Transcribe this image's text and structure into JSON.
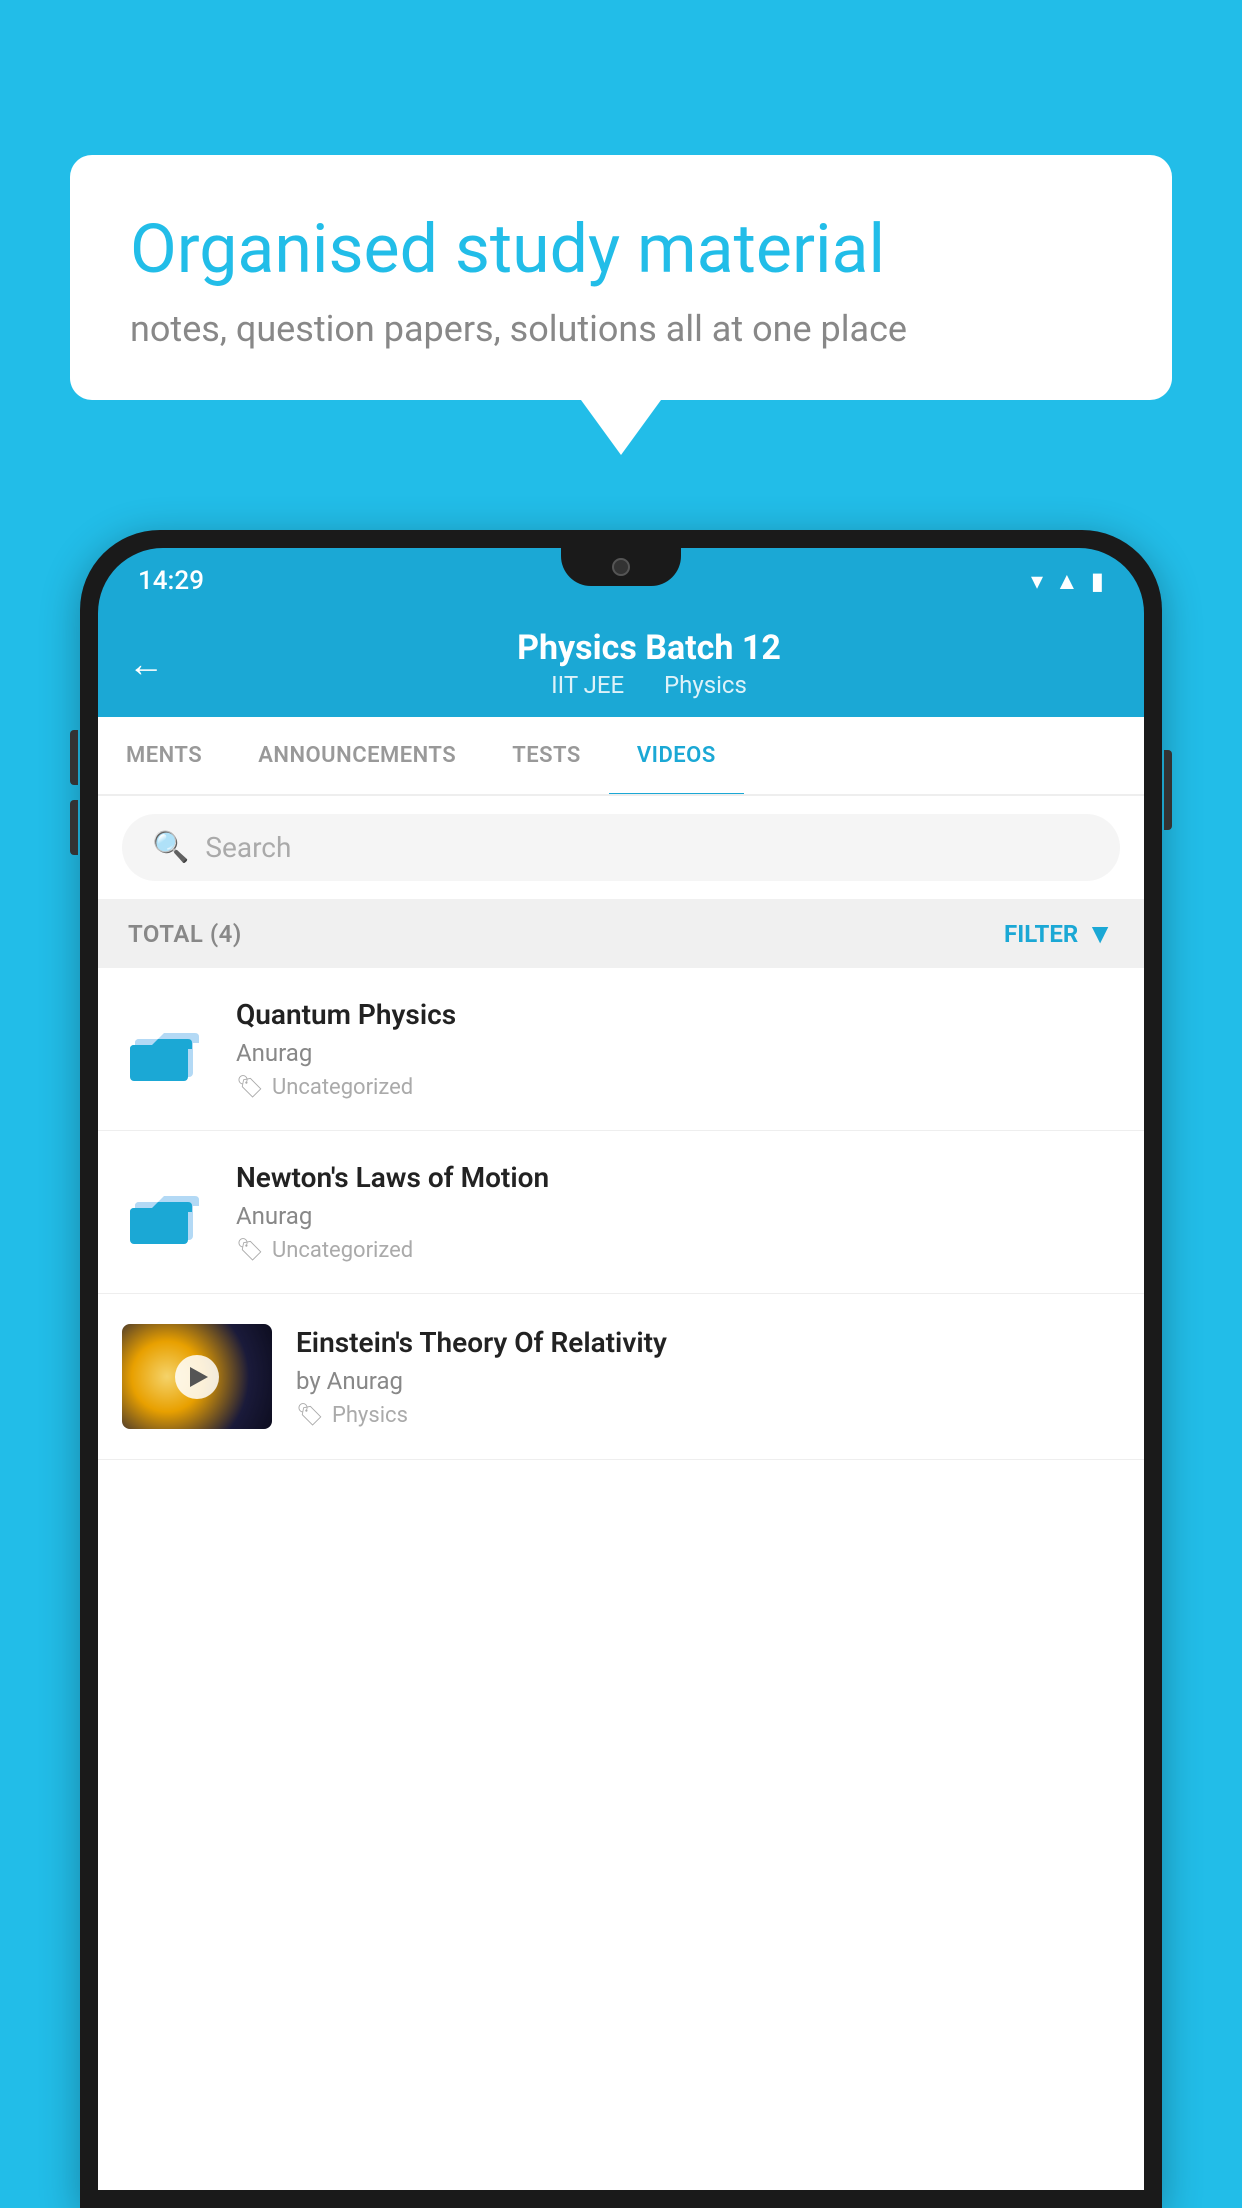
{
  "background": {
    "color": "#22BDE8"
  },
  "speech_bubble": {
    "title": "Organised study material",
    "subtitle": "notes, question papers, solutions all at one place"
  },
  "phone": {
    "status_bar": {
      "time": "14:29",
      "icons": [
        "wifi",
        "signal",
        "battery"
      ]
    },
    "header": {
      "back_label": "←",
      "title": "Physics Batch 12",
      "subtitle_part1": "IIT JEE",
      "subtitle_part2": "Physics"
    },
    "tabs": [
      {
        "label": "MENTS",
        "active": false
      },
      {
        "label": "ANNOUNCEMENTS",
        "active": false
      },
      {
        "label": "TESTS",
        "active": false
      },
      {
        "label": "VIDEOS",
        "active": true
      }
    ],
    "search": {
      "placeholder": "Search"
    },
    "filter_bar": {
      "total_label": "TOTAL (4)",
      "filter_label": "FILTER"
    },
    "videos": [
      {
        "title": "Quantum Physics",
        "author": "Anurag",
        "tag": "Uncategorized",
        "has_thumbnail": false
      },
      {
        "title": "Newton's Laws of Motion",
        "author": "Anurag",
        "tag": "Uncategorized",
        "has_thumbnail": false
      },
      {
        "title": "Einstein's Theory Of Relativity",
        "author": "by Anurag",
        "tag": "Physics",
        "has_thumbnail": true
      }
    ]
  }
}
